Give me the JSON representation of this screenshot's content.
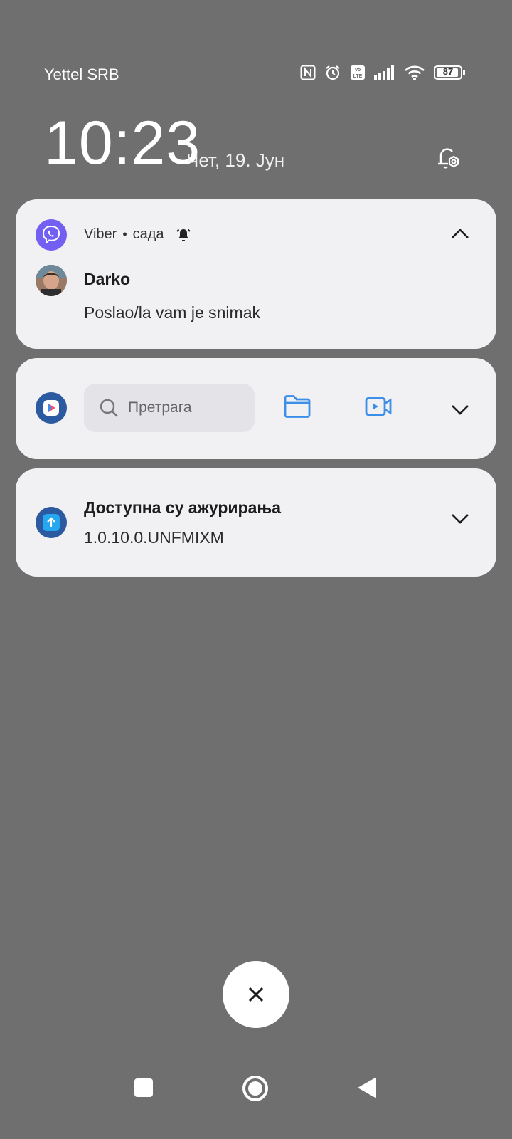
{
  "status_bar": {
    "carrier": "Yettel SRB",
    "icons": [
      "nfc-icon",
      "alarm-icon",
      "volte-icon",
      "signal-icon",
      "wifi-icon",
      "battery-icon"
    ],
    "volte_label": "Vo\nLTE",
    "battery_level": "87"
  },
  "lockscreen": {
    "time": "10:23",
    "date": "Чет, 19. Јун"
  },
  "notifications": {
    "viber": {
      "app_name": "Viber",
      "separator": "•",
      "time": "сада",
      "sender": "Darko",
      "message": "Poslao/la vam je snimak",
      "accent": "#7360f2"
    },
    "search_widget": {
      "placeholder": "Претрага",
      "icons": [
        "play-icon",
        "folder-icon",
        "video-icon"
      ],
      "accent": "#3d8ee8"
    },
    "update": {
      "title": "Доступна су ажурирања",
      "version": "1.0.10.0.UNFMIXM"
    }
  },
  "controls": {
    "dismiss_icon": "close-icon"
  },
  "colors": {
    "background": "#6f6f6f",
    "card": "#f1f1f4"
  }
}
